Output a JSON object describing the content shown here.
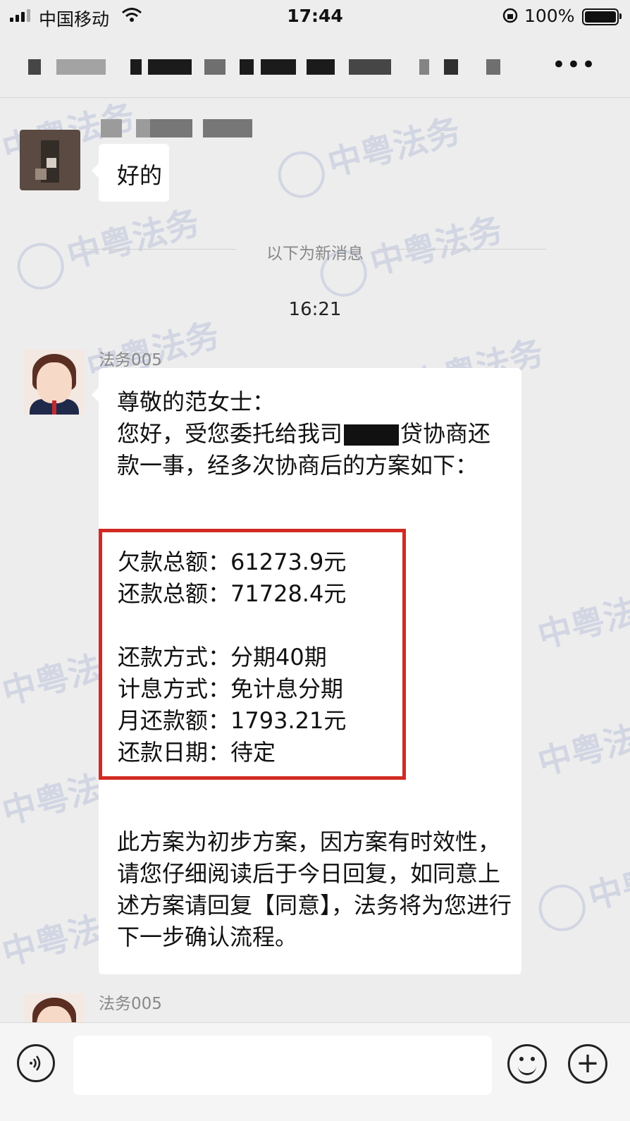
{
  "status_bar": {
    "carrier": "中国移动",
    "time": "17:44",
    "battery": "100%"
  },
  "nav": {
    "more_label": "•••"
  },
  "watermark_text": "中粤法务",
  "messages": {
    "first_reply": "好的",
    "divider": "以下为新消息",
    "timestamp": "16:21",
    "sender": "法务005",
    "greeting": "尊敬的范女士：",
    "intro_a": "您好，受您委托给我司",
    "intro_b": "贷协商还款一事，经多次协商后的方案如下：",
    "plan": {
      "row1": "欠款总额：61273.9元",
      "row2": "还款总额：71728.4元",
      "row3": "还款方式：分期40期",
      "row4": "计息方式：免计息分期",
      "row5": "月还款额：1793.21元",
      "row6": "还款日期：待定"
    },
    "closing": "此方案为初步方案，因方案有时效性，请您仔细阅读后于今日回复，如同意上述方案请回复【同意】，法务将为您进行下一步确认流程。",
    "sender_2": "法务005"
  },
  "input_bar": {
    "voice_icon": "voice-icon",
    "emoji_icon": "emoji-icon",
    "plus_icon": "plus-icon"
  }
}
